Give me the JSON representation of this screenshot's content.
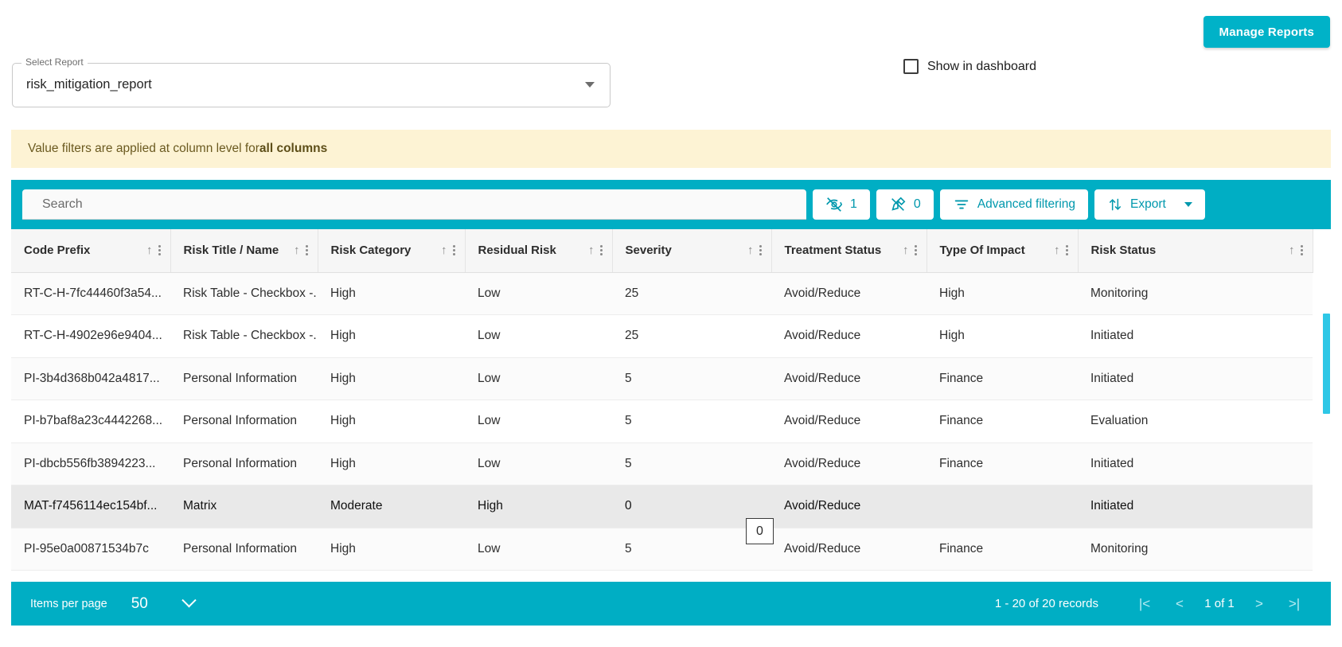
{
  "header": {
    "manage_reports_label": "Manage Reports",
    "show_in_dashboard_label": "Show in dashboard"
  },
  "select_report": {
    "legend": "Select Report",
    "value": "risk_mitigation_report"
  },
  "banner": {
    "text_prefix": "Value filters are applied at column level for ",
    "text_strong": "all columns"
  },
  "toolbar": {
    "search_placeholder": "Search",
    "hidden_columns_count": "1",
    "pinned_columns_count": "0",
    "advanced_filtering_label": "Advanced filtering",
    "export_label": "Export"
  },
  "table": {
    "columns": [
      "Code Prefix",
      "Risk Title / Name",
      "Risk Category",
      "Residual Risk",
      "Severity",
      "Treatment Status",
      "Type Of Impact",
      "Risk Status"
    ],
    "rows": [
      {
        "cells": [
          "RT-C-H-7fc44460f3a54...",
          "Risk Table - Checkbox -...",
          "High",
          "Low",
          "25",
          "Avoid/Reduce",
          "High",
          "Monitoring"
        ],
        "selected": false
      },
      {
        "cells": [
          "RT-C-H-4902e96e9404...",
          "Risk Table - Checkbox -...",
          "High",
          "Low",
          "25",
          "Avoid/Reduce",
          "High",
          "Initiated"
        ],
        "selected": false
      },
      {
        "cells": [
          "PI-3b4d368b042a4817...",
          "Personal Information",
          "High",
          "Low",
          "5",
          "Avoid/Reduce",
          "Finance",
          "Initiated"
        ],
        "selected": false
      },
      {
        "cells": [
          "PI-b7baf8a23c4442268...",
          "Personal Information",
          "High",
          "Low",
          "5",
          "Avoid/Reduce",
          "Finance",
          "Evaluation"
        ],
        "selected": false
      },
      {
        "cells": [
          "PI-dbcb556fb3894223...",
          "Personal Information",
          "High",
          "Low",
          "5",
          "Avoid/Reduce",
          "Finance",
          "Initiated"
        ],
        "selected": false
      },
      {
        "cells": [
          "MAT-f7456114ec154bf...",
          "Matrix",
          "Moderate",
          "High",
          "0",
          "Avoid/Reduce",
          "",
          "Initiated"
        ],
        "selected": true
      },
      {
        "cells": [
          "PI-95e0a00871534b7c",
          "Personal Information",
          "High",
          "Low",
          "5",
          "Avoid/Reduce",
          "Finance",
          "Monitoring"
        ],
        "selected": false
      }
    ]
  },
  "cell_overlay": {
    "value": "0"
  },
  "footer": {
    "items_per_page_label": "Items per page",
    "items_per_page_value": "50",
    "records_label": "1 - 20 of 20 records",
    "page_of": "1 of 1",
    "first_page_icon": "|<",
    "prev_page_icon": "<",
    "next_page_icon": ">",
    "last_page_icon": ">|"
  },
  "colors": {
    "accent": "#00aec4",
    "button": "#00b2c8",
    "banner_bg": "#fdf3d4",
    "scrollbar": "#2ec7e6"
  }
}
